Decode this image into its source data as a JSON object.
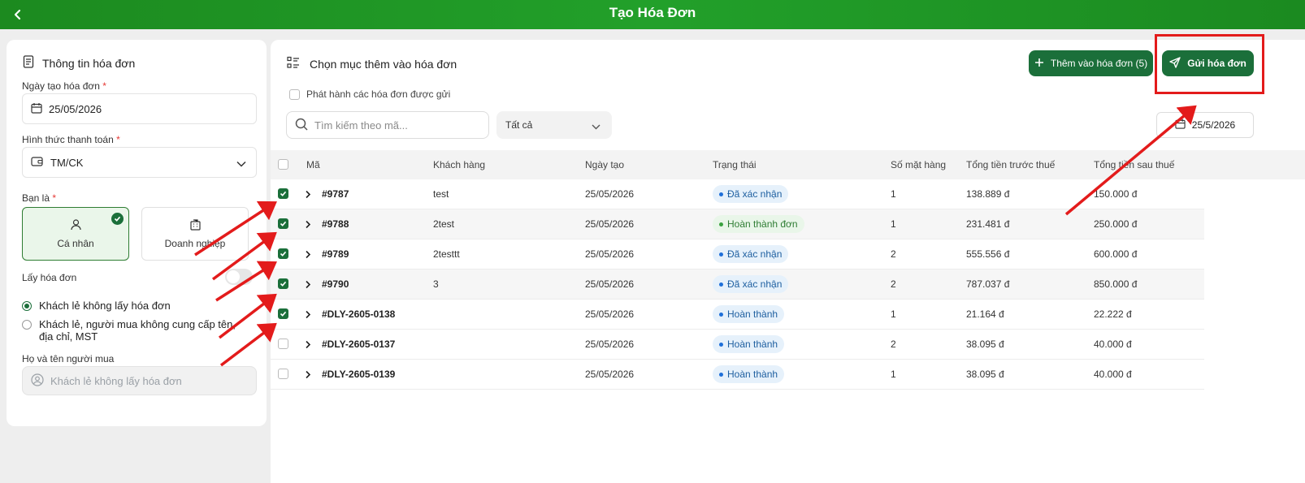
{
  "header": {
    "title": "Tạo Hóa Đơn"
  },
  "sidebar": {
    "title": "Thông tin hóa đơn",
    "date_label": "Ngày tạo hóa đơn",
    "date_value": "25/05/2026",
    "payment_label": "Hình thức thanh toán",
    "payment_value": "TM/CK",
    "role_label": "Bạn là",
    "roles": [
      {
        "label": "Cá nhân"
      },
      {
        "label": "Doanh nghiệp"
      }
    ],
    "take_invoice_label": "Lấy hóa đơn",
    "options": [
      {
        "label": "Khách lẻ không lấy hóa đơn"
      },
      {
        "label": "Khách lẻ, người mua không cung cấp tên, địa chỉ, MST"
      }
    ],
    "buyer_label": "Họ và tên người mua",
    "buyer_placeholder": "Khách lẻ không lấy hóa đơn"
  },
  "main": {
    "title": "Chọn mục thêm vào hóa đơn",
    "issue_label": "Phát hành các hóa đơn được gửi",
    "add_button": "Thêm vào hóa đơn (5)",
    "send_button": "Gửi hóa đơn",
    "search_placeholder": "Tìm kiếm theo mã...",
    "filter_value": "Tất cả",
    "date_filter": "25/5/2026"
  },
  "table": {
    "columns": [
      "Mã",
      "Khách hàng",
      "Ngày tạo",
      "Trạng thái",
      "Số mặt hàng",
      "Tổng tiền trước thuế",
      "Tổng tiền sau thuế"
    ],
    "rows": [
      {
        "code": "#9787",
        "customer": "test",
        "date": "25/05/2026",
        "status": "Đã xác nhận",
        "items": "1",
        "pre_tax": "138.889 đ",
        "post_tax": "150.000 đ"
      },
      {
        "code": "#9788",
        "customer": "2test",
        "date": "25/05/2026",
        "status": "Hoàn thành đơn",
        "items": "1",
        "pre_tax": "231.481 đ",
        "post_tax": "250.000 đ"
      },
      {
        "code": "#9789",
        "customer": "2testtt",
        "date": "25/05/2026",
        "status": "Đã xác nhận",
        "items": "2",
        "pre_tax": "555.556 đ",
        "post_tax": "600.000 đ"
      },
      {
        "code": "#9790",
        "customer": "3",
        "date": "25/05/2026",
        "status": "Đã xác nhận",
        "items": "2",
        "pre_tax": "787.037 đ",
        "post_tax": "850.000 đ"
      },
      {
        "code": "#DLY-2605-0138",
        "customer": "",
        "date": "25/05/2026",
        "status": "Hoàn thành",
        "items": "1",
        "pre_tax": "21.164 đ",
        "post_tax": "22.222 đ"
      },
      {
        "code": "#DLY-2605-0137",
        "customer": "",
        "date": "25/05/2026",
        "status": "Hoàn thành",
        "items": "2",
        "pre_tax": "38.095 đ",
        "post_tax": "40.000 đ"
      },
      {
        "code": "#DLY-2605-0139",
        "customer": "",
        "date": "25/05/2026",
        "status": "Hoàn thành",
        "items": "1",
        "pre_tax": "38.095 đ",
        "post_tax": "40.000 đ"
      }
    ]
  },
  "colors": {
    "brand_green": "#1b6f3a",
    "header_green": "#22a02a",
    "annotation_red": "#e31b1b"
  },
  "icons": [
    "back-arrow-icon",
    "document-icon",
    "calendar-icon",
    "wallet-icon",
    "chevron-down-icon",
    "user-icon",
    "building-icon",
    "list-icon",
    "plus-icon",
    "send-icon",
    "search-icon",
    "chevron-right-icon",
    "check-icon"
  ]
}
